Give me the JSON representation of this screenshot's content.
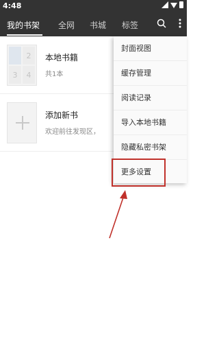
{
  "status_bar": {
    "time": "4:48"
  },
  "toolbar": {
    "tabs": [
      {
        "label": "我的书架"
      },
      {
        "label": "全网"
      },
      {
        "label": "书城"
      },
      {
        "label": "标签"
      }
    ]
  },
  "books": [
    {
      "title": "本地书籍",
      "subtitle": "共1本",
      "cover_numbers": [
        "2",
        "3",
        "4"
      ]
    },
    {
      "title": "添加新书",
      "subtitle": "欢迎前往发现区，"
    }
  ],
  "menu": {
    "items": [
      {
        "label": "封面视图"
      },
      {
        "label": "缓存管理"
      },
      {
        "label": "阅读记录"
      },
      {
        "label": "导入本地书籍"
      },
      {
        "label": "隐藏私密书架"
      },
      {
        "label": "更多设置"
      }
    ]
  },
  "annotation": {
    "color": "#c0302a"
  },
  "colors": {
    "toolbar_bg": "#333333",
    "accent": "#ffffff"
  }
}
